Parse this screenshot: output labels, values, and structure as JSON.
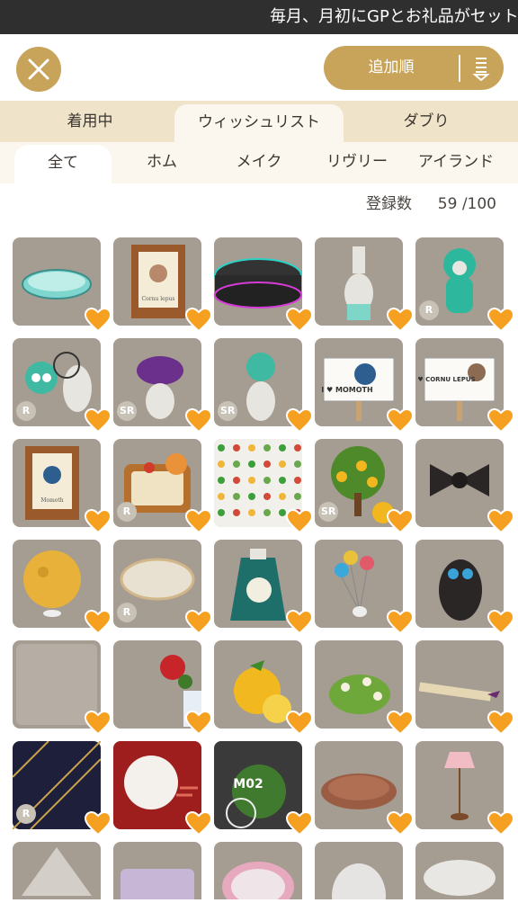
{
  "ticker": {
    "text": "毎月、月初にGPとお礼品がセット"
  },
  "header": {
    "close_icon": "close-icon",
    "sort_label": "追加順",
    "sort_icon": "sort-icon"
  },
  "tabs_primary": [
    {
      "label": "着用中"
    },
    {
      "label": "ウィッシュリスト"
    },
    {
      "label": "ダブり"
    }
  ],
  "tabs_secondary": [
    {
      "label": "全て"
    },
    {
      "label": "ホム"
    },
    {
      "label": "メイク"
    },
    {
      "label": "リヴリー"
    },
    {
      "label": "アイランド"
    }
  ],
  "count": {
    "label": "登録数",
    "value": "59 /100"
  },
  "items": [
    {
      "rarity": ""
    },
    {
      "rarity": ""
    },
    {
      "rarity": ""
    },
    {
      "rarity": ""
    },
    {
      "rarity": "R"
    },
    {
      "rarity": "R"
    },
    {
      "rarity": "SR"
    },
    {
      "rarity": "SR"
    },
    {
      "rarity": ""
    },
    {
      "rarity": ""
    },
    {
      "rarity": ""
    },
    {
      "rarity": "R"
    },
    {
      "rarity": ""
    },
    {
      "rarity": "SR"
    },
    {
      "rarity": ""
    },
    {
      "rarity": ""
    },
    {
      "rarity": "R"
    },
    {
      "rarity": ""
    },
    {
      "rarity": ""
    },
    {
      "rarity": ""
    },
    {
      "rarity": ""
    },
    {
      "rarity": ""
    },
    {
      "rarity": ""
    },
    {
      "rarity": ""
    },
    {
      "rarity": ""
    },
    {
      "rarity": "R"
    },
    {
      "rarity": ""
    },
    {
      "rarity": ""
    },
    {
      "rarity": ""
    },
    {
      "rarity": ""
    },
    {
      "rarity": ""
    },
    {
      "rarity": ""
    },
    {
      "rarity": ""
    },
    {
      "rarity": ""
    },
    {
      "rarity": ""
    }
  ],
  "item_text": {
    "love_momoth": "I ♥ MOMOTH",
    "love_cornu": "I ♥ CORNU LEPUS",
    "m02": "M02",
    "frame1": "Cornu lepus",
    "frame2": "Momoth"
  },
  "colors": {
    "accent": "#c8a35a",
    "heart": "#f5a021",
    "tab_bg": "#efe3c9",
    "cell_bg": "#a59c92"
  }
}
